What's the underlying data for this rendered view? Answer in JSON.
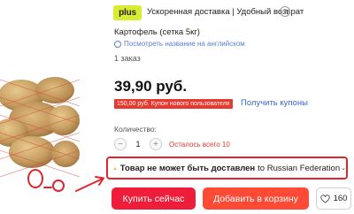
{
  "colors": {
    "plus_badge": "#d9ec2e",
    "coupon_bg": "#e8392f",
    "link": "#3567d0",
    "warning_border": "#e0262c",
    "buy_now": "#ee1e3a",
    "add_to_cart": "#ff4a36"
  },
  "header": {
    "badge": "plus",
    "delivery": "Ускоренная доставка | Удобный возврат",
    "help_icon": "question-circle-icon"
  },
  "product": {
    "title": "Картофель (сетка 5кг)",
    "translate_link": "Посмотреть название на английском",
    "orders": "1 заказ",
    "price": "39,90 руб."
  },
  "coupon": {
    "text": "150,00 руб. Купон нового пользователя",
    "get_coupons": "Получить купоны"
  },
  "quantity": {
    "label": "Количество:",
    "value": "1",
    "minus": "−",
    "plus": "+",
    "stock": "Осталось всего 10"
  },
  "warning": {
    "icon": "warning-triangle-icon",
    "bold_text": "Товар не может быть доставлен",
    "destination": "to Russian Federation",
    "chevron": "⌄"
  },
  "actions": {
    "buy_now": "Купить сейчас",
    "add_to_cart": "Добавить в корзину",
    "wishlist_count": "160"
  }
}
